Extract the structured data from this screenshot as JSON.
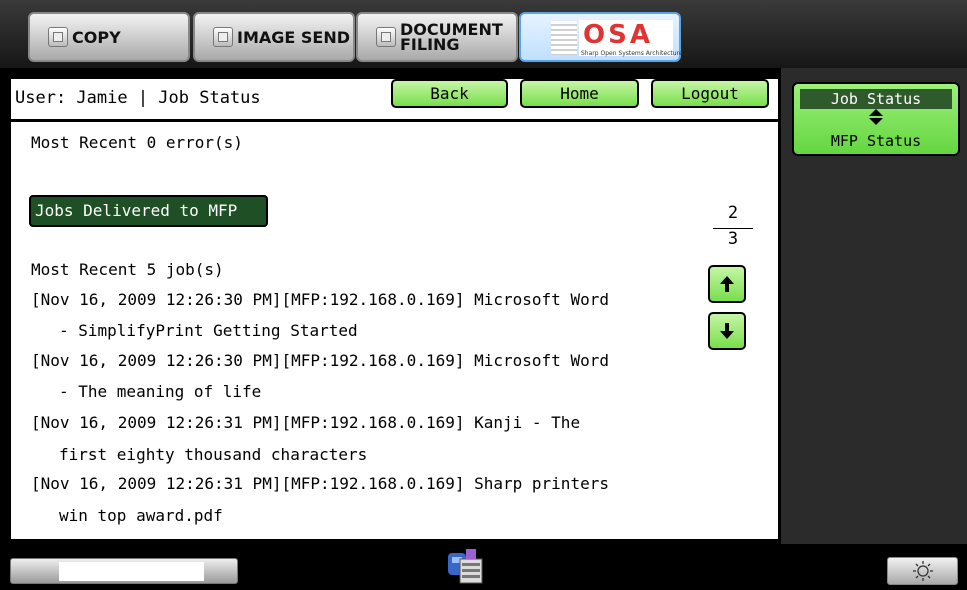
{
  "top_tabs": {
    "copy": "COPY",
    "image_send": "IMAGE SEND",
    "document_filing_line1": "DOCUMENT",
    "document_filing_line2": "FILING",
    "osa_logo": "OSA",
    "osa_subtext": "Sharp Open Systems Architecture"
  },
  "header": {
    "user_status": "User: Jamie | Job Status",
    "back_label": "Back",
    "home_label": "Home",
    "logout_label": "Logout"
  },
  "errors_text": "Most Recent 0 error(s)",
  "jobs_delivered_label": "Jobs Delivered to MFP",
  "jobs_count_text": "Most Recent 5 job(s)",
  "jobs": [
    {
      "line1": "[Nov 16, 2009 12:26:30 PM][MFP:192.168.0.169] Microsoft Word",
      "line2": "- SimplifyPrint Getting Started"
    },
    {
      "line1": "[Nov 16, 2009 12:26:30 PM][MFP:192.168.0.169] Microsoft Word",
      "line2": "- The meaning of life"
    },
    {
      "line1": "[Nov 16, 2009 12:26:31 PM][MFP:192.168.0.169] Kanji - The",
      "line2": "first eighty thousand characters"
    },
    {
      "line1": "[Nov 16, 2009 12:26:31 PM][MFP:192.168.0.169] Sharp printers",
      "line2": "win top award.pdf"
    }
  ],
  "pagination": {
    "current": "2",
    "total": "3"
  },
  "side_toggle": {
    "top_label": "Job Status",
    "bottom_label": "MFP Status"
  },
  "icons": {
    "copy": "copy-icon",
    "image_send": "image-send-icon",
    "document_filing": "document-filing-icon",
    "page_up": "arrow-up-icon",
    "page_down": "arrow-down-icon",
    "toggle": "up-down-triangle-icon",
    "device": "device-icon",
    "brightness": "sun-icon"
  },
  "colors": {
    "button_green": "#78df4b",
    "selected_dark_green": "#1f4f24",
    "osa_red": "#e03333"
  }
}
